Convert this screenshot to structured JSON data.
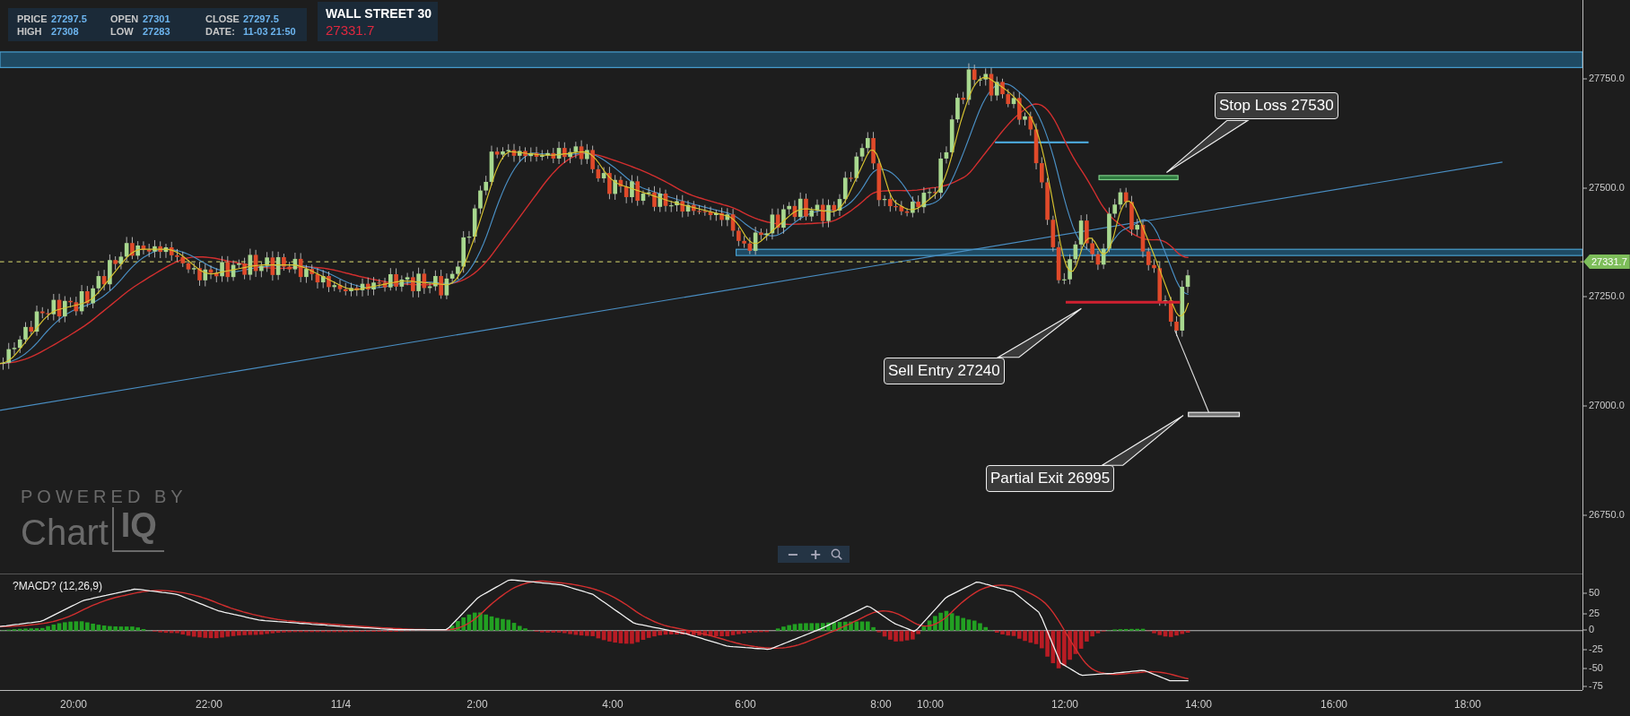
{
  "quote": {
    "fields": [
      {
        "label": "PRICE",
        "value": "27297.5"
      },
      {
        "label": "OPEN",
        "value": "27301"
      },
      {
        "label": "CLOSE",
        "value": "27297.5"
      },
      {
        "label": "HIGH",
        "value": "27308"
      },
      {
        "label": "LOW",
        "value": "27283"
      },
      {
        "label": "DATE:",
        "value": "11-03 21:50"
      }
    ]
  },
  "instrument": {
    "name": "WALL STREET 30",
    "price": "27331.7"
  },
  "annotations": [
    {
      "text": "Stop Loss 27530"
    },
    {
      "text": "Sell Entry 27240"
    },
    {
      "text": "Partial Exit 26995"
    }
  ],
  "logo": {
    "tagline": "POWERED BY",
    "brand": "Chart",
    "brand_suffix": "IQ"
  },
  "zoom_controls": {
    "zoom_out": "−",
    "zoom_in": "+"
  },
  "price_axis": {
    "ticks": [
      "27750.0",
      "27500.0",
      "27250.0",
      "27000.0",
      "26750.0"
    ],
    "current_price": "27331.7"
  },
  "macd": {
    "label": "?MACD? (12,26,9)",
    "ticks": [
      "50",
      "25",
      "0",
      "-25",
      "-50",
      "-75"
    ]
  },
  "time_axis": {
    "labels": [
      "20:00",
      "22:00",
      "11/4",
      "2:00",
      "4:00",
      "6:00",
      "8:00",
      "10:00",
      "12:00",
      "14:00",
      "16:00",
      "18:00"
    ]
  }
}
